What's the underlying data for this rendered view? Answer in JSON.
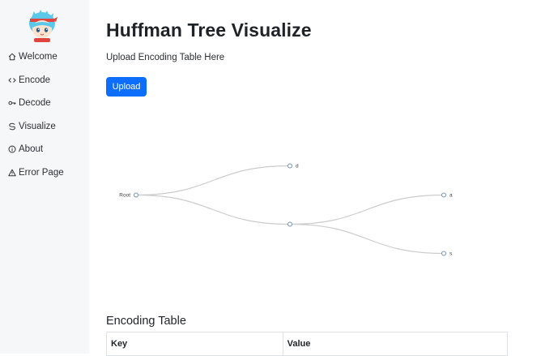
{
  "sidebar": {
    "avatar_icon": "anime-avatar-icon",
    "items": [
      {
        "label": "Welcome",
        "icon": "home-icon"
      },
      {
        "label": "Encode",
        "icon": "code-icon"
      },
      {
        "label": "Decode",
        "icon": "key-icon"
      },
      {
        "label": "Visualize",
        "icon": "swirl-icon"
      },
      {
        "label": "About",
        "icon": "info-icon"
      },
      {
        "label": "Error Page",
        "icon": "warning-icon"
      }
    ]
  },
  "main": {
    "title": "Huffman Tree Visualize",
    "subtitle": "Upload Encoding Table Here",
    "upload_label": "Upload",
    "tree": {
      "root_label": "Root",
      "nodes": [
        {
          "label": "d"
        },
        {
          "label": ""
        },
        {
          "label": "a"
        },
        {
          "label": "s"
        }
      ]
    },
    "table_title": "Encoding Table",
    "table_headers": [
      "Key",
      "Value"
    ]
  },
  "colors": {
    "accent": "#0d6efd",
    "sidebar_bg": "#f6f7f9",
    "link_stroke": "#cccccc",
    "node_stroke": "#6f8fb5"
  }
}
